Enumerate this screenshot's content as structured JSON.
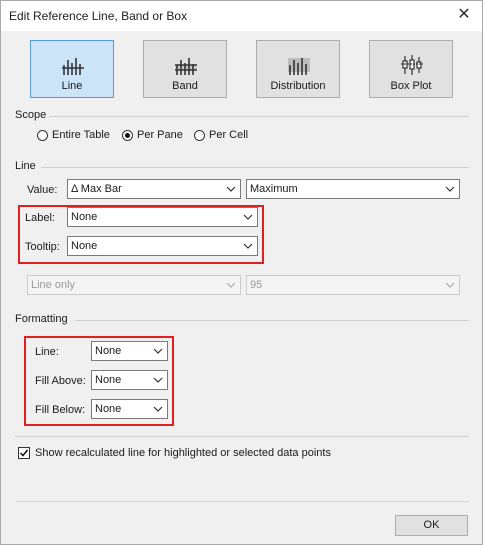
{
  "window": {
    "title": "Edit Reference Line, Band or Box"
  },
  "types": [
    {
      "label": "Line",
      "icon": "line-chart-icon",
      "selected": true
    },
    {
      "label": "Band",
      "icon": "band-chart-icon",
      "selected": false
    },
    {
      "label": "Distribution",
      "icon": "distribution-chart-icon",
      "selected": false
    },
    {
      "label": "Box Plot",
      "icon": "box-plot-icon",
      "selected": false
    }
  ],
  "scope": {
    "heading": "Scope",
    "options": [
      {
        "label": "Entire Table",
        "checked": false
      },
      {
        "label": "Per Pane",
        "checked": true
      },
      {
        "label": "Per Cell",
        "checked": false
      }
    ]
  },
  "line": {
    "heading": "Line",
    "value_label": "Value:",
    "value_field": "Δ  Max Bar",
    "aggregation": "Maximum",
    "label_label": "Label:",
    "label_value": "None",
    "tooltip_label": "Tooltip:",
    "tooltip_value": "None",
    "line_only": "Line only",
    "percent": "95"
  },
  "formatting": {
    "heading": "Formatting",
    "line_label": "Line:",
    "line_value": "None",
    "fill_above_label": "Fill Above:",
    "fill_above_value": "None",
    "fill_below_label": "Fill Below:",
    "fill_below_value": "None"
  },
  "recalc": {
    "label": "Show recalculated line for highlighted or selected data points",
    "checked": true
  },
  "buttons": {
    "ok": "OK"
  }
}
